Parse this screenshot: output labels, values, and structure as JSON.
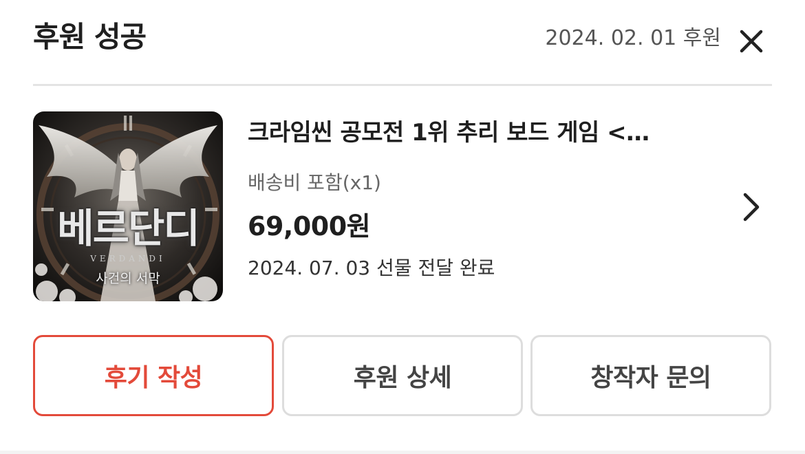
{
  "header": {
    "title": "후원 성공",
    "date": "2024. 02. 01 후원",
    "close_icon": "close-icon"
  },
  "product": {
    "thumbnail": {
      "title": "베르단디",
      "subtitle": "VERDANDI",
      "subtitle2": "사건의 서막"
    },
    "title": "크라임씬 공모전 1위 추리 보드 게임 <…",
    "option": "배송비 포함(x1)",
    "price": "69,000원",
    "status": "2024. 07. 03 선물 전달 완료",
    "chevron_icon": "chevron-right-icon"
  },
  "actions": {
    "review_label": "후기 작성",
    "detail_label": "후원 상세",
    "contact_label": "창작자 문의"
  },
  "colors": {
    "accent": "#e34a3a",
    "border": "#dddddd",
    "divider": "#e4e4e4",
    "text_primary": "#1f1f1f",
    "text_secondary": "#666666"
  }
}
